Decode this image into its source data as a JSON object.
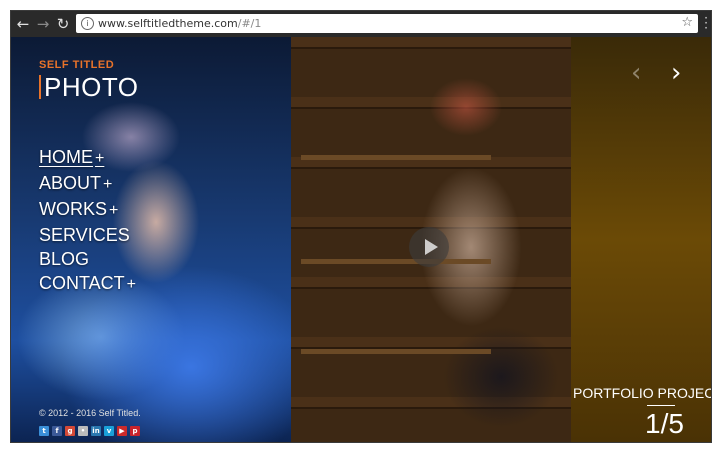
{
  "browser": {
    "url_main": "www.selftitledtheme.com",
    "url_dim": "/#/1",
    "back_icon": "back-arrow-icon",
    "forward_icon": "forward-arrow-icon",
    "reload_icon": "reload-icon",
    "info_icon": "info-icon",
    "star_icon": "bookmark-star-icon"
  },
  "site": {
    "logo_top": "SELF TITLED",
    "logo_main": "PHOTO",
    "accent_color": "#e8732a",
    "menu": [
      {
        "label": "HOME",
        "plus": "+"
      },
      {
        "label": "ABOUT",
        "plus": "+"
      },
      {
        "label": "WORKS",
        "plus": "+"
      },
      {
        "label": "SERVICES",
        "plus": ""
      },
      {
        "label": "BLOG",
        "plus": ""
      },
      {
        "label": "CONTACT",
        "plus": "+"
      }
    ],
    "copyright": "© 2012 - 2016 Self Titled.",
    "social": [
      {
        "icon": "twitter-icon",
        "glyph": "t",
        "color": "#3a8fd8"
      },
      {
        "icon": "facebook-icon",
        "glyph": "f",
        "color": "#3b5998"
      },
      {
        "icon": "google-plus-icon",
        "glyph": "g",
        "color": "#d34836"
      },
      {
        "icon": "flickr-icon",
        "glyph": "•",
        "color": "#bbbbbb"
      },
      {
        "icon": "linkedin-icon",
        "glyph": "in",
        "color": "#2a78b0"
      },
      {
        "icon": "vimeo-icon",
        "glyph": "v",
        "color": "#1aa0d8"
      },
      {
        "icon": "youtube-icon",
        "glyph": "▶",
        "color": "#cc2a2a"
      },
      {
        "icon": "pinterest-icon",
        "glyph": "p",
        "color": "#c8232c"
      }
    ]
  },
  "slider": {
    "prev_icon": "chevron-left-icon",
    "next_icon": "chevron-right-icon",
    "play_icon": "play-icon",
    "project_label": "PORTFOLIO PROJECT",
    "counter": "1/5",
    "progress": 0.2
  }
}
